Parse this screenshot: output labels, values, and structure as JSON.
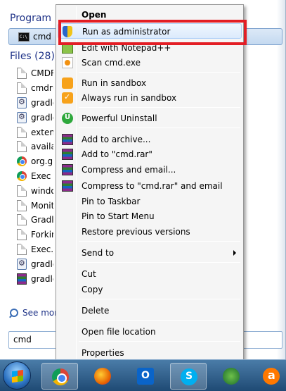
{
  "start_menu": {
    "programs_header": "Program",
    "programs_item": "cmd",
    "files_header": "Files (28)",
    "files": [
      {
        "label": "CMDR",
        "icon": "document-icon"
      },
      {
        "label": "cmdru",
        "icon": "document-icon"
      },
      {
        "label": "gradle",
        "icon": "gear-file-icon"
      },
      {
        "label": "gradle",
        "icon": "gear-file-icon"
      },
      {
        "label": "extens",
        "icon": "document-icon"
      },
      {
        "label": "availab",
        "icon": "document-icon"
      },
      {
        "label": "org.gr",
        "icon": "chrome-icon"
      },
      {
        "label": "Exec",
        "icon": "chrome-icon"
      },
      {
        "label": "windo",
        "icon": "document-icon"
      },
      {
        "label": "Monit",
        "icon": "document-icon"
      },
      {
        "label": "Gradle",
        "icon": "document-icon"
      },
      {
        "label": "Forkin",
        "icon": "document-icon"
      },
      {
        "label": "Exec.ja",
        "icon": "document-icon"
      },
      {
        "label": "gradle",
        "icon": "gear-file-icon"
      },
      {
        "label": "gradle",
        "icon": "winrar-icon"
      }
    ],
    "see_more": "See more",
    "search_value": "cmd"
  },
  "context_menu": {
    "open": "Open",
    "run_as_admin": "Run as administrator",
    "edit_notepad": "Edit with Notepad++",
    "scan": "Scan cmd.exe",
    "run_sandbox": "Run in sandbox",
    "always_sandbox": "Always run in sandbox",
    "powerful_uninstall": "Powerful Uninstall",
    "add_archive": "Add to archive...",
    "add_rar": "Add to \"cmd.rar\"",
    "compress_email": "Compress and email...",
    "compress_rar_email": "Compress to \"cmd.rar\" and email",
    "pin_taskbar": "Pin to Taskbar",
    "pin_start": "Pin to Start Menu",
    "restore_versions": "Restore previous versions",
    "send_to": "Send to",
    "cut": "Cut",
    "copy": "Copy",
    "delete": "Delete",
    "open_location": "Open file location",
    "properties": "Properties"
  },
  "taskbar": {
    "apps": [
      "chrome-icon",
      "firefox-icon",
      "outlook-icon",
      "skype-icon",
      "idm-icon",
      "avast-icon"
    ]
  },
  "colors": {
    "highlight_box": "#e31e25",
    "group_header": "#1e3287",
    "taskbar": "#2a5a88"
  }
}
